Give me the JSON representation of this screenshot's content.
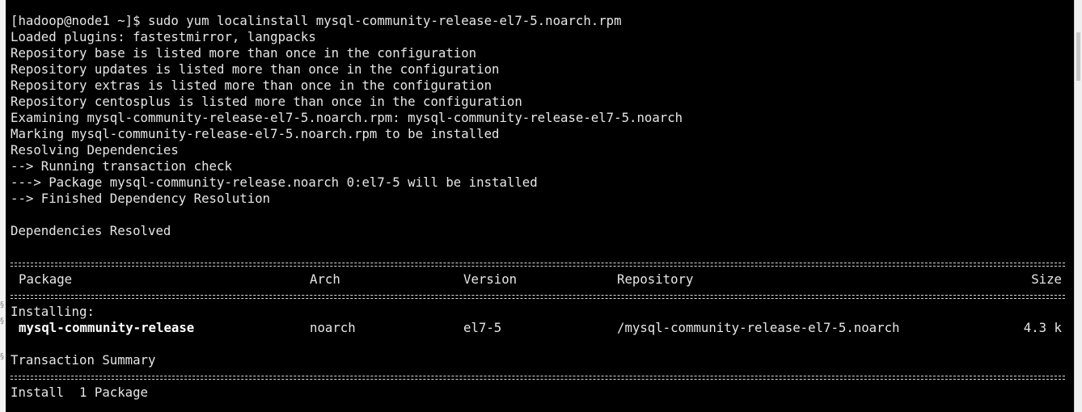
{
  "terminal": {
    "prompt": "[hadoop@node1 ~]$ sudo yum localinstall mysql-community-release-el7-5.noarch.rpm",
    "output_lines": [
      "Loaded plugins: fastestmirror, langpacks",
      "Repository base is listed more than once in the configuration",
      "Repository updates is listed more than once in the configuration",
      "Repository extras is listed more than once in the configuration",
      "Repository centosplus is listed more than once in the configuration",
      "Examining mysql-community-release-el7-5.noarch.rpm: mysql-community-release-el7-5.noarch",
      "Marking mysql-community-release-el7-5.noarch.rpm to be installed",
      "Resolving Dependencies",
      "--> Running transaction check",
      "---> Package mysql-community-release.noarch 0:el7-5 will be installed",
      "--> Finished Dependency Resolution",
      "",
      "Dependencies Resolved",
      ""
    ],
    "table": {
      "headers": {
        "package": "Package",
        "arch": "Arch",
        "version": "Version",
        "repository": "Repository",
        "size": "Size"
      },
      "section_label": "Installing:",
      "rows": [
        {
          "package": "mysql-community-release",
          "arch": "noarch",
          "version": "el7-5",
          "repository": "/mysql-community-release-el7-5.noarch",
          "size": "4.3 k"
        }
      ]
    },
    "summary_title": "Transaction Summary",
    "summary_line": "Install  1 Package"
  },
  "colors": {
    "background": "#000000",
    "foreground": "#e6e6e6"
  }
}
